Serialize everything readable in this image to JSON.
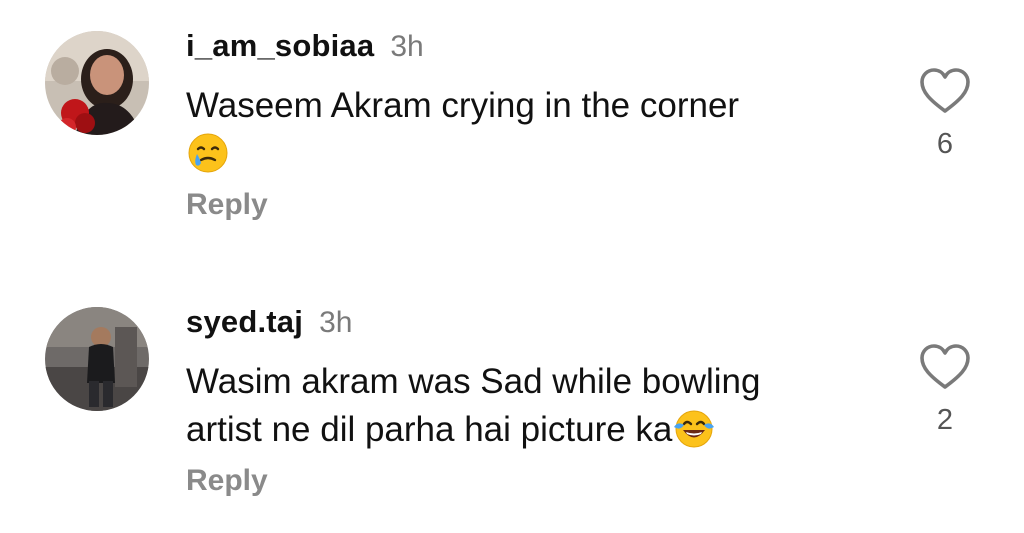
{
  "comments": [
    {
      "username": "i_am_sobiaa",
      "time": "3h",
      "lines": [
        "Waseem Akram crying in the corner",
        ""
      ],
      "emoji": "smiling-face-with-tear-emoji",
      "reply_label": "Reply",
      "like_icon": "heart-outline-icon",
      "like_count": "6"
    },
    {
      "username": "syed.taj",
      "time": "3h",
      "lines": [
        "Wasim akram was Sad while bowling",
        "artist ne dil parha hai picture ka"
      ],
      "emoji": "face-with-tears-of-joy-emoji",
      "reply_label": "Reply",
      "like_icon": "heart-outline-icon",
      "like_count": "2"
    }
  ],
  "colors": {
    "text": "#111111",
    "secondary": "#7a7a7a",
    "reply": "#8a8a8a",
    "background": "#ffffff"
  }
}
